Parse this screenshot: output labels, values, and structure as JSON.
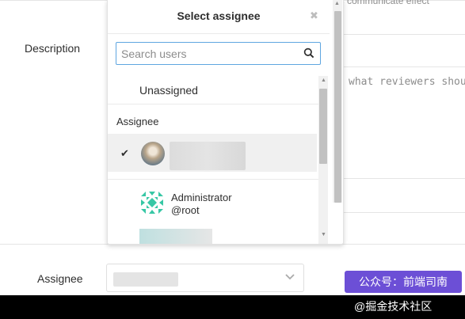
{
  "form": {
    "description_label": "Description",
    "assignee_label": "Assignee",
    "top_hint_fragment": "ors communicate effect",
    "textarea_placeholder_fragment": "what reviewers shou"
  },
  "dropdown": {
    "title": "Select assignee",
    "close_glyph": "✖",
    "search_placeholder": "Search users",
    "unassigned_label": "Unassigned",
    "section_header": "Assignee",
    "check_glyph": "✔",
    "users": [
      {
        "name": "Administrator",
        "handle": "@root"
      }
    ]
  },
  "scrollbar": {
    "up_glyph": "▲",
    "down_glyph": "▼"
  },
  "assignee_select": {
    "chevron_glyph": "⌵"
  },
  "watermark": {
    "badge": "公众号：前端司南",
    "footer": "@掘金技术社区"
  },
  "colors": {
    "accent_blue": "#5fa6e0",
    "watermark_purple": "#6c4fd6",
    "selected_row": "#f0f0f0",
    "identicon_green": "#37c7a5"
  },
  "icons": {
    "search": "search-icon",
    "close": "close-icon",
    "check": "check-icon",
    "chevron": "chevron-down-icon"
  }
}
